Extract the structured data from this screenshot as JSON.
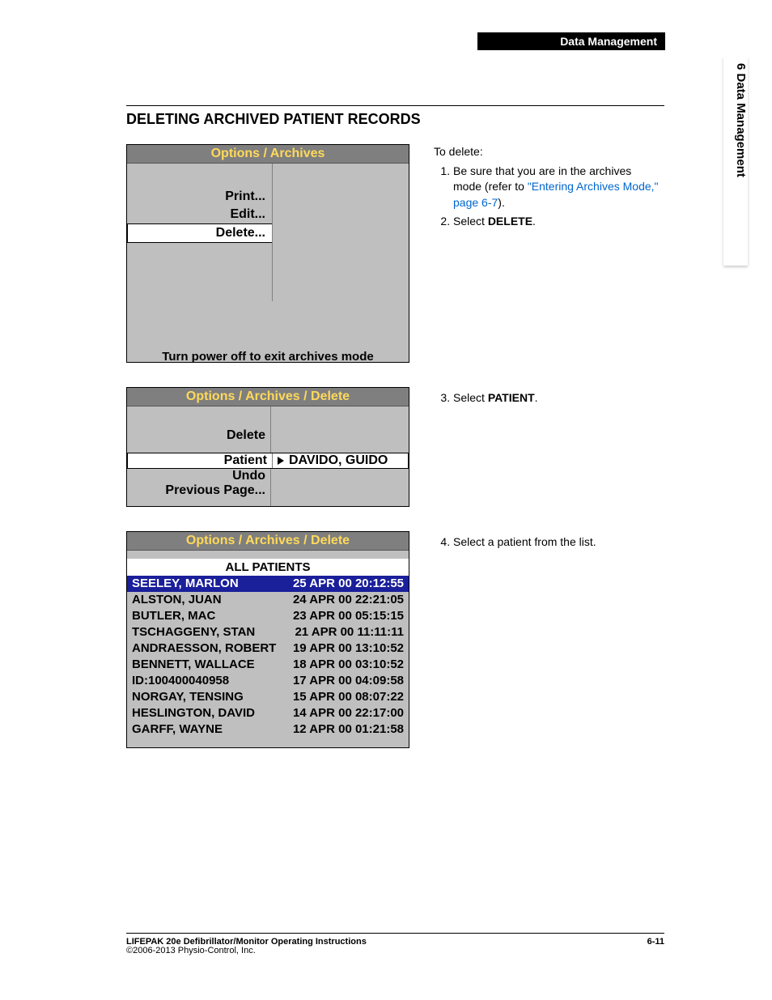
{
  "header": {
    "section_label": "Data Management"
  },
  "side_chapter": "6 Data Management",
  "section_title": "DELETING ARCHIVED PATIENT RECORDS",
  "panel1": {
    "title": "Options / Archives",
    "menu": {
      "print": "Print...",
      "edit": "Edit...",
      "delete": "Delete..."
    },
    "footer": "Turn power off to exit archives mode"
  },
  "panel2": {
    "title": "Options / Archives / Delete",
    "menu": {
      "delete": "Delete",
      "patient": "Patient",
      "undo": "Undo",
      "prev": "Previous Page..."
    },
    "patient_value": "DAVIDO, GUIDO"
  },
  "panel3": {
    "title": "Options / Archives / Delete",
    "subhead": "ALL PATIENTS",
    "patients": [
      {
        "name": "SEELEY, MARLON",
        "ts": "25 APR 00 20:12:55",
        "selected": true
      },
      {
        "name": "ALSTON, JUAN",
        "ts": "24 APR 00 22:21:05",
        "selected": false
      },
      {
        "name": "BUTLER, MAC",
        "ts": "23 APR 00 05:15:15",
        "selected": false
      },
      {
        "name": "TSCHAGGENY, STAN",
        "ts": "21 APR 00 11:11:11",
        "selected": false
      },
      {
        "name": "ANDRAESSON, ROBERT",
        "ts": "19 APR 00 13:10:52",
        "selected": false
      },
      {
        "name": "BENNETT, WALLACE",
        "ts": "18 APR 00 03:10:52",
        "selected": false
      },
      {
        "name": "ID:100400040958",
        "ts": "17 APR 00 04:09:58",
        "selected": false
      },
      {
        "name": "NORGAY, TENSING",
        "ts": "15 APR 00 08:07:22",
        "selected": false
      },
      {
        "name": "HESLINGTON, DAVID",
        "ts": "14 APR 00 22:17:00",
        "selected": false
      },
      {
        "name": "GARFF, WAYNE",
        "ts": "12 APR 00 01:21:58",
        "selected": false
      }
    ]
  },
  "instr": {
    "intro": "To delete:",
    "step1a": "Be sure that you are in the archives mode (refer to ",
    "step1link": "\"Entering Archives Mode,\" page 6-7",
    "step1b": ").",
    "step2a": "Select ",
    "step2b": "DELETE",
    "step2c": ".",
    "step3a": "Select ",
    "step3b": "PATIENT",
    "step3c": ".",
    "step4": "Select a patient from the list."
  },
  "footer": {
    "product": "LIFEPAK 20e Defibrillator/Monitor Operating Instructions",
    "page": "6-11",
    "copyright": "©2006-2013 Physio-Control, Inc."
  }
}
